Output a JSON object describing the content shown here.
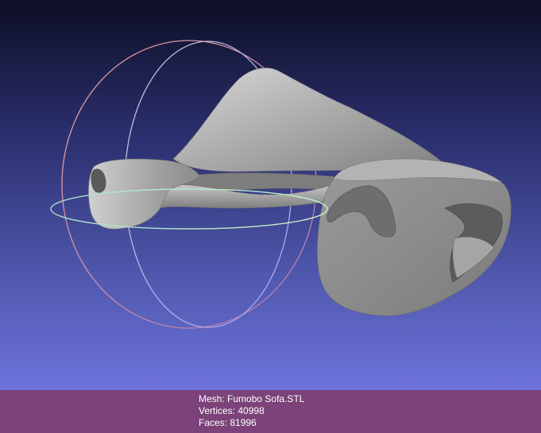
{
  "info": {
    "mesh_label": "Mesh:",
    "mesh_name": "Fumobo Sofa.STL",
    "vertices_label": "Vertices:",
    "vertices": "40998",
    "faces_label": "Faces:",
    "faces": "81996"
  },
  "colors": {
    "background_top": "#0d0f25",
    "background_bottom": "#6d73da",
    "info_bar": "#7b4379",
    "mesh_gray": "#9a9a9a",
    "trackball_x": "#d98a8a",
    "trackball_y": "#b0b0e8",
    "trackball_z": "#a8e0a8"
  },
  "icons": {
    "trackball": "trackball-gizmo",
    "mesh": "mesh-model"
  }
}
